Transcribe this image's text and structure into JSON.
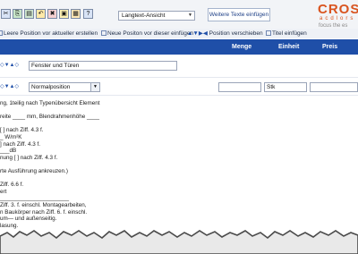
{
  "toolbar": {
    "view_dropdown": "Langtext-Ansicht",
    "weitere_button": "Weitere Texte einfügen"
  },
  "logo": {
    "word": "CROSSI",
    "sub": "acdlors",
    "slogan": "focus the es"
  },
  "actions": {
    "leere": "Leere Position vor aktueller erstellen",
    "neue": "Neue Positon vor dieser einfügen",
    "verschieben": "Position verschieben",
    "titel": "Titel einfügen"
  },
  "header": {
    "menge": "Menge",
    "einheit": "Einheit",
    "preis": "Preis"
  },
  "row1": {
    "title_value": "Fenster und Türen"
  },
  "row2": {
    "type_value": "Normalposition",
    "einheit_value": "Stk"
  },
  "text_lines": [
    "ng, 1teilig nach Typenübersicht Element",
    "",
    "reite ____ mm, Blendrahmenhöhe ____",
    "",
    "[ ] nach Ziff. 4.3 f.",
    "_ W/m²K",
    "] nach Ziff. 4.3 f.",
    "___dB",
    "nung [ ] nach Ziff. 4.3 f.",
    "",
    "rte Ausführung ankreuzen.)",
    "",
    "Ziff. 6.6 f.",
    "ert",
    "______________________",
    "Ziff. 3. f. einschl. Montagearbeiten,",
    "n Baukörper nach Ziff. 6. f. einschl.",
    "um— und außenseitig.",
    "lasung."
  ],
  "colors": {
    "header_bg": "#1f4fa8",
    "logo_orange": "#d9541f"
  }
}
